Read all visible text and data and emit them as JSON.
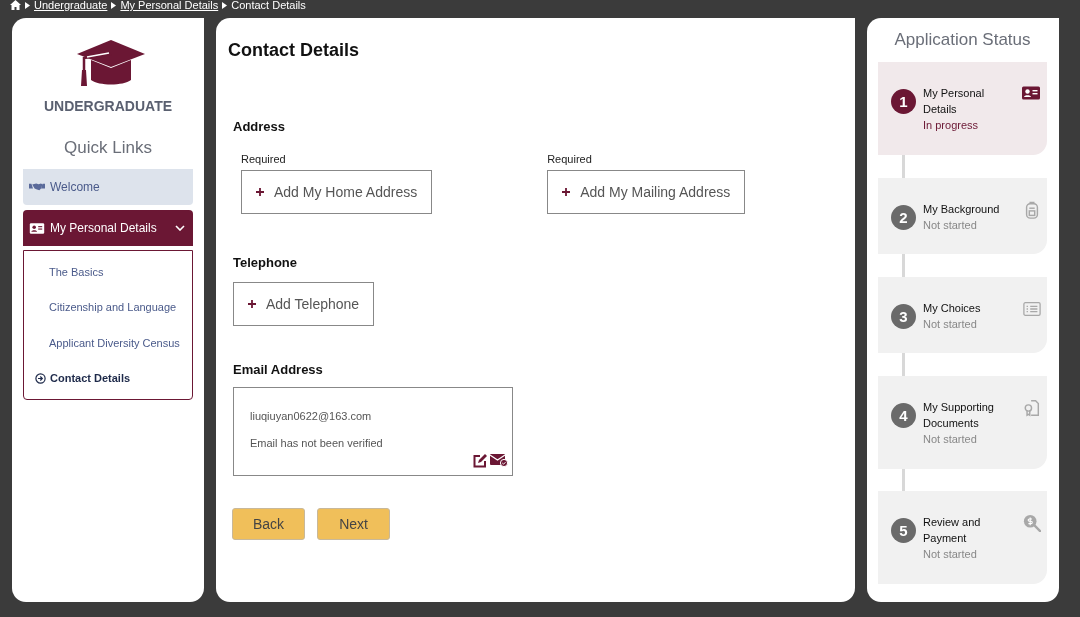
{
  "breadcrumb": [
    {
      "label": "Undergraduate",
      "link": true
    },
    {
      "label": "My Personal Details",
      "link": true
    },
    {
      "label": "Contact Details",
      "link": false
    }
  ],
  "brand": {
    "title": "UNDERGRADUATE"
  },
  "quick_links": {
    "title": "Quick Links",
    "items": [
      {
        "label": "Welcome",
        "selected": false
      },
      {
        "label": "My Personal Details",
        "selected": true,
        "expanded": true,
        "children": [
          {
            "label": "The Basics",
            "selected": false
          },
          {
            "label": "Citizenship and Language",
            "selected": false
          },
          {
            "label": "Applicant Diversity Census",
            "selected": false
          },
          {
            "label": "Contact Details",
            "selected": true
          }
        ]
      }
    ]
  },
  "main": {
    "title": "Contact Details",
    "address": {
      "label": "Address",
      "buttons": [
        {
          "required": "Required",
          "label": "Add My Home Address"
        },
        {
          "required": "Required",
          "label": "Add My Mailing Address"
        }
      ]
    },
    "telephone": {
      "label": "Telephone",
      "buttons": [
        {
          "label": "Add Telephone"
        }
      ]
    },
    "email": {
      "label": "Email Address",
      "value": "liuqiuyan0622@163.com",
      "note": "Email has not been verified"
    },
    "nav_buttons": [
      "Back",
      "Next"
    ]
  },
  "application_status": {
    "title": "Application Status",
    "steps": [
      {
        "number": "1",
        "title": "My Personal Details",
        "status": "In progress",
        "selected": true
      },
      {
        "number": "2",
        "title": "My Background",
        "status": "Not started",
        "selected": false
      },
      {
        "number": "3",
        "title": "My Choices",
        "status": "Not started",
        "selected": false
      },
      {
        "number": "4",
        "title": "My Supporting Documents",
        "status": "Not started",
        "selected": false
      },
      {
        "number": "5",
        "title": "Review and Payment",
        "status": "Not started",
        "selected": false
      }
    ]
  }
}
